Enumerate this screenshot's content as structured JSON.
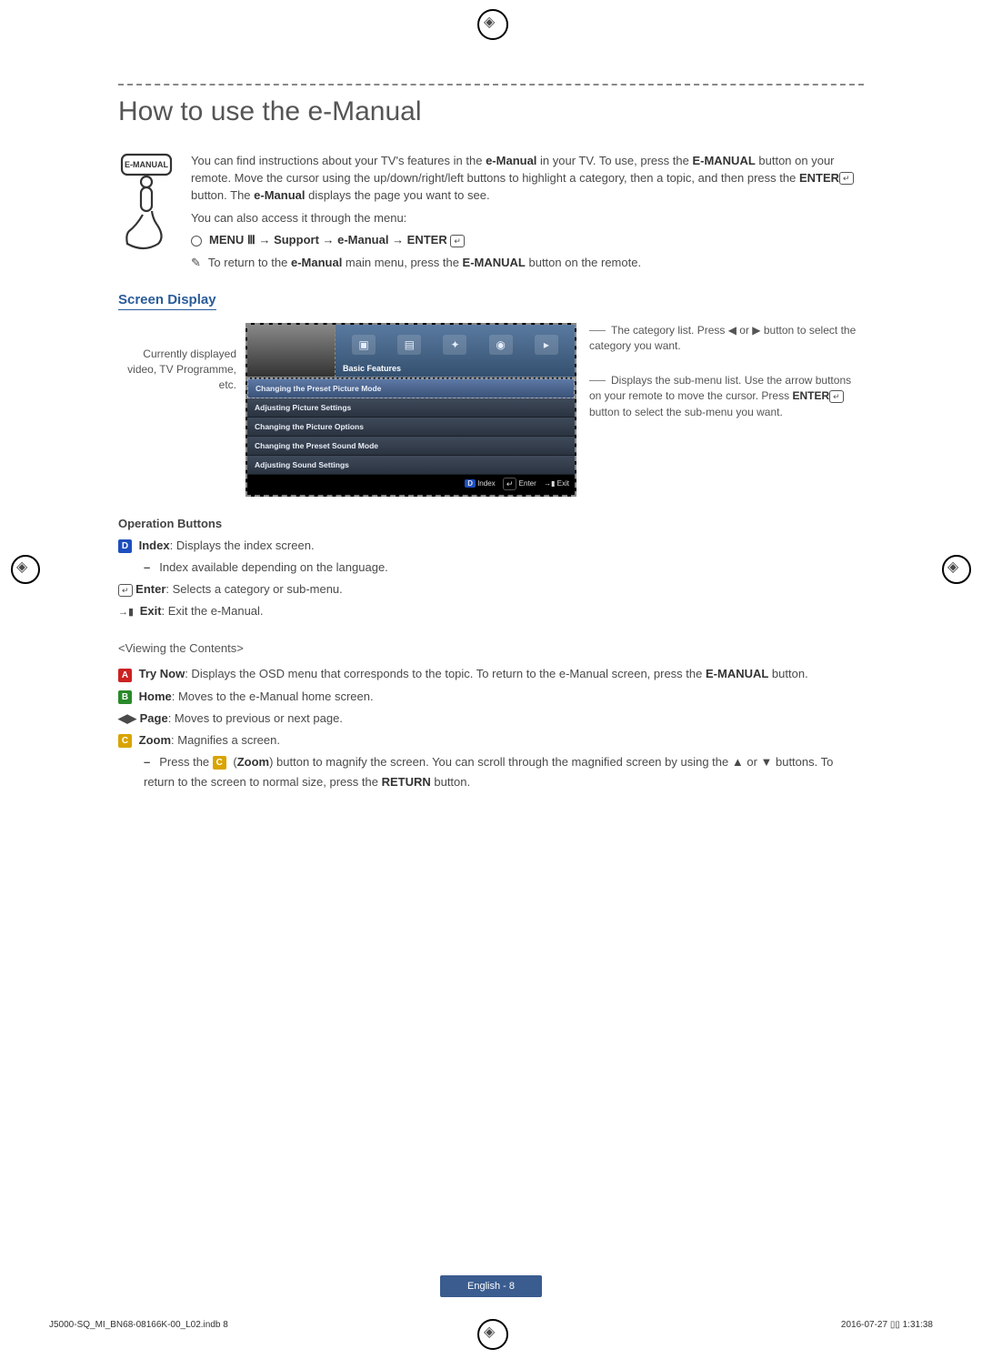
{
  "title": "How to use the e-Manual",
  "intro": {
    "p1a": "You can find instructions about your TV's features in the ",
    "p1b": "e-Manual",
    "p1c": " in your TV. To use, press the ",
    "p1d": "E-MANUAL",
    "p1e": " button on your remote. Move the cursor using the up/down/right/left buttons to highlight a category, then a topic, and then press the ",
    "p1f": "ENTER",
    "p1g": " button. The ",
    "p1h": "e-Manual",
    "p1i": " displays the page you want to see.",
    "p2": "You can also access it through the menu:",
    "path": "MENU Ⅲ → Support → e-Manual → ENTER",
    "note_a": "To return to the ",
    "note_b": "e-Manual",
    "note_c": " main menu, press the ",
    "note_d": "E-MANUAL",
    "note_e": " button on the remote.",
    "remote_label": "E-MANUAL"
  },
  "sections": {
    "screen_display": "Screen Display"
  },
  "diagram": {
    "left_caption": "Currently displayed video, TV Programme, etc.",
    "tab_label": "Basic Features",
    "menu_items": [
      "Changing the Preset Picture Mode",
      "Adjusting Picture Settings",
      "Changing the Picture Options",
      "Changing the Preset Sound Mode",
      "Adjusting Sound Settings"
    ],
    "footer_index": "Index",
    "footer_enter": "Enter",
    "footer_exit": "Exit",
    "right_note1": "The category list. Press ◀ or ▶ button to select the category you want.",
    "right_note2_a": "Displays the sub-menu list. Use the arrow buttons on your remote to move the cursor. Press ",
    "right_note2_b": "ENTER",
    "right_note2_c": " button to select the sub-menu you want."
  },
  "ops": {
    "heading": "Operation Buttons",
    "index_label": "Index",
    "index_desc": ": Displays the index screen.",
    "index_sub": "Index available depending on the language.",
    "enter_label": "Enter",
    "enter_desc": ": Selects a category or sub-menu.",
    "exit_label": "Exit",
    "exit_desc": ": Exit the e-Manual."
  },
  "viewing": {
    "heading": "<Viewing the Contents>",
    "trynow_label": "Try Now",
    "trynow_desc_a": ": Displays the OSD menu that corresponds to the topic. To return to the e-Manual screen, press the ",
    "trynow_desc_b": "E-MANUAL",
    "trynow_desc_c": " button.",
    "home_label": "Home",
    "home_desc": ": Moves to the e-Manual home screen.",
    "page_label": "Page",
    "page_desc": ": Moves to previous or next page.",
    "zoom_label": "Zoom",
    "zoom_desc": ": Magnifies a screen.",
    "zoom_sub_a": "Press the ",
    "zoom_sub_b": "Zoom",
    "zoom_sub_c": ") button to magnify the screen. You can scroll through the magnified screen by using the ▲ or ▼ buttons. To return to the screen to normal size, press the ",
    "zoom_sub_d": "RETURN",
    "zoom_sub_e": " button."
  },
  "footer": {
    "page_badge": "English - 8",
    "job_left": "J5000-SQ_MI_BN68-08166K-00_L02.indb   8",
    "job_right": "2016-07-27   ▯▯ 1:31:38"
  }
}
